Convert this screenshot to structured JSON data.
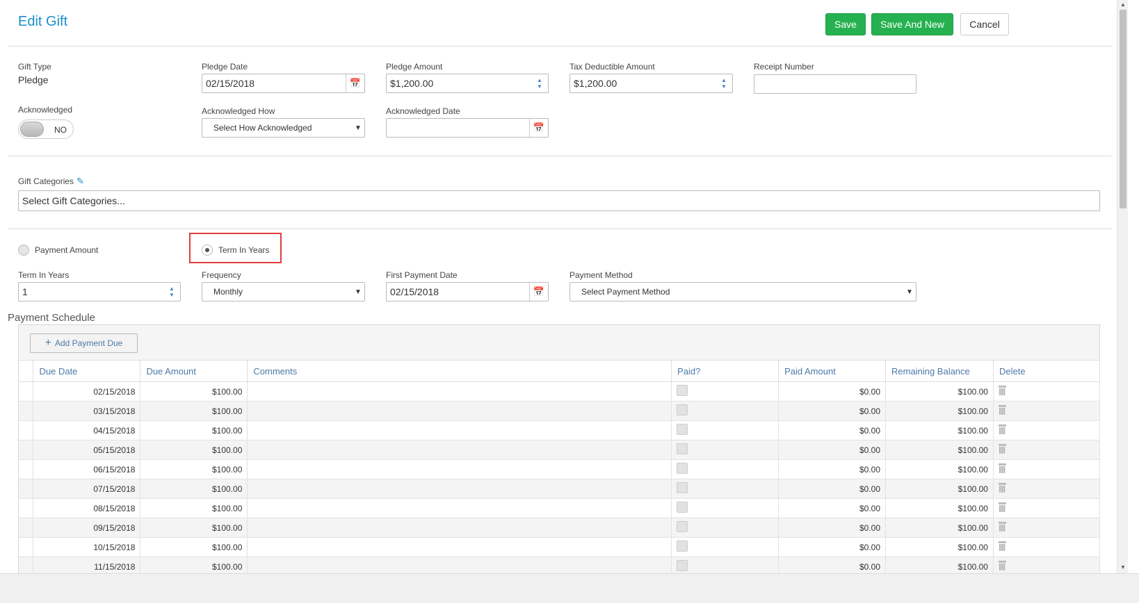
{
  "header": {
    "title": "Edit Gift",
    "save_label": "Save",
    "save_new_label": "Save And New",
    "cancel_label": "Cancel"
  },
  "gift": {
    "type_label": "Gift Type",
    "type_value": "Pledge",
    "pledge_date_label": "Pledge Date",
    "pledge_date": "02/15/2018",
    "pledge_amount_label": "Pledge Amount",
    "pledge_amount": "$1,200.00",
    "tax_label": "Tax Deductible Amount",
    "tax_amount": "$1,200.00",
    "receipt_label": "Receipt Number",
    "receipt_value": ""
  },
  "ack": {
    "label": "Acknowledged",
    "toggle_text": "NO",
    "how_label": "Acknowledged How",
    "how_value": "Select How Acknowledged",
    "date_label": "Acknowledged Date",
    "date_value": ""
  },
  "categories": {
    "label": "Gift Categories",
    "placeholder": "Select Gift Categories..."
  },
  "payment_mode": {
    "option1": "Payment Amount",
    "option2": "Term In Years",
    "selected": "Term In Years"
  },
  "terms": {
    "term_label": "Term In Years",
    "term_value": "1",
    "frequency_label": "Frequency",
    "frequency_value": "Monthly",
    "first_date_label": "First Payment Date",
    "first_date": "02/15/2018",
    "method_label": "Payment Method",
    "method_value": "Select Payment Method"
  },
  "schedule": {
    "title": "Payment Schedule",
    "add_label": "Add Payment Due",
    "columns": [
      "Due Date",
      "Due Amount",
      "Comments",
      "Paid?",
      "Paid Amount",
      "Remaining Balance",
      "Delete"
    ],
    "rows": [
      {
        "due_date": "02/15/2018",
        "due_amount": "$100.00",
        "comments": "",
        "paid": false,
        "paid_amount": "$0.00",
        "remaining": "$100.00"
      },
      {
        "due_date": "03/15/2018",
        "due_amount": "$100.00",
        "comments": "",
        "paid": false,
        "paid_amount": "$0.00",
        "remaining": "$100.00"
      },
      {
        "due_date": "04/15/2018",
        "due_amount": "$100.00",
        "comments": "",
        "paid": false,
        "paid_amount": "$0.00",
        "remaining": "$100.00"
      },
      {
        "due_date": "05/15/2018",
        "due_amount": "$100.00",
        "comments": "",
        "paid": false,
        "paid_amount": "$0.00",
        "remaining": "$100.00"
      },
      {
        "due_date": "06/15/2018",
        "due_amount": "$100.00",
        "comments": "",
        "paid": false,
        "paid_amount": "$0.00",
        "remaining": "$100.00"
      },
      {
        "due_date": "07/15/2018",
        "due_amount": "$100.00",
        "comments": "",
        "paid": false,
        "paid_amount": "$0.00",
        "remaining": "$100.00"
      },
      {
        "due_date": "08/15/2018",
        "due_amount": "$100.00",
        "comments": "",
        "paid": false,
        "paid_amount": "$0.00",
        "remaining": "$100.00"
      },
      {
        "due_date": "09/15/2018",
        "due_amount": "$100.00",
        "comments": "",
        "paid": false,
        "paid_amount": "$0.00",
        "remaining": "$100.00"
      },
      {
        "due_date": "10/15/2018",
        "due_amount": "$100.00",
        "comments": "",
        "paid": false,
        "paid_amount": "$0.00",
        "remaining": "$100.00"
      },
      {
        "due_date": "11/15/2018",
        "due_amount": "$100.00",
        "comments": "",
        "paid": false,
        "paid_amount": "$0.00",
        "remaining": "$100.00"
      }
    ]
  },
  "colors": {
    "accent": "#1a8fc9",
    "save_green": "#25b14f",
    "highlight_red": "#e03c3c",
    "grid_header": "#4d79a8"
  },
  "icons": {
    "calendar": "calendar-icon",
    "spinner": "spinner-arrows-icon",
    "edit": "edit-icon",
    "trash": "trash-icon",
    "plus": "plus-icon"
  }
}
